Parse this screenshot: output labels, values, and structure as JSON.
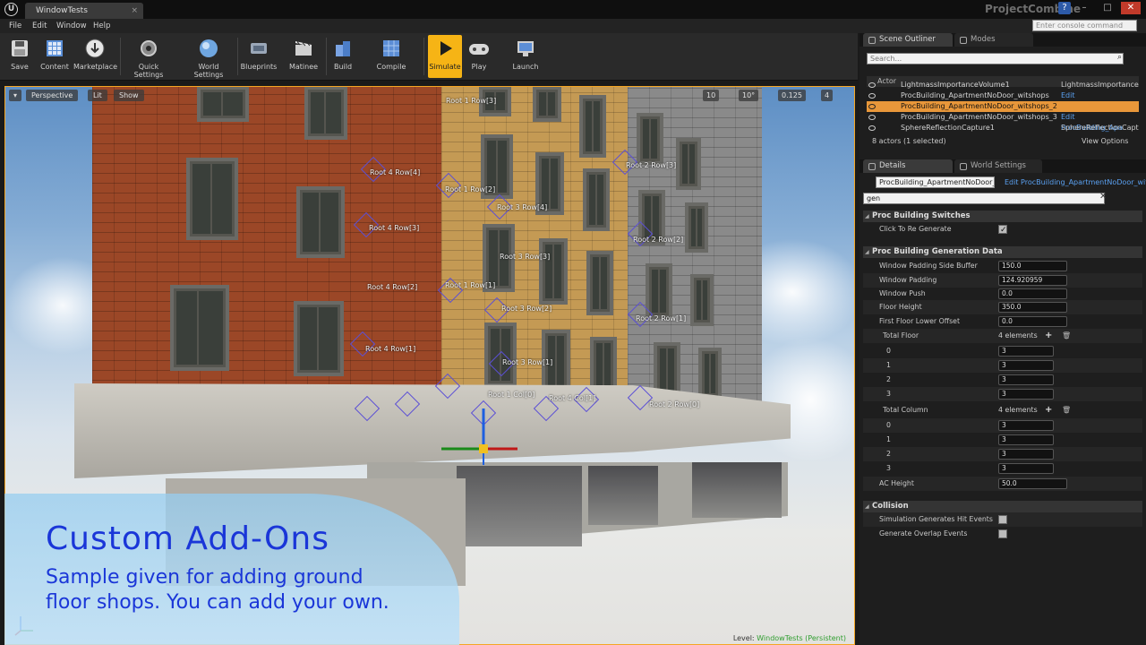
{
  "window": {
    "logo": "U",
    "doc_tab": "WindowTests",
    "doc_tab_close": "×",
    "project_name": "ProjectCombine",
    "help": "?",
    "minimize": "–",
    "maximize": "□",
    "close": "✕"
  },
  "menu": {
    "items": [
      "File",
      "Edit",
      "Window",
      "Help"
    ],
    "console_placeholder": "Enter console command"
  },
  "toolbar": {
    "buttons": [
      {
        "label": "Save",
        "icon": "save-icon"
      },
      {
        "label": "Content",
        "icon": "content-browser-icon"
      },
      {
        "label": "Marketplace",
        "icon": "marketplace-icon"
      },
      {
        "label": "Quick Settings",
        "icon": "quick-settings-icon"
      },
      {
        "label": "World Settings",
        "icon": "world-settings-icon"
      },
      {
        "label": "Blueprints",
        "icon": "blueprints-icon"
      },
      {
        "label": "Matinee",
        "icon": "matinee-icon"
      },
      {
        "label": "Build",
        "icon": "build-icon"
      },
      {
        "label": "Compile",
        "icon": "compile-icon"
      },
      {
        "label": "Simulate",
        "icon": "simulate-icon"
      },
      {
        "label": "Play",
        "icon": "play-icon"
      },
      {
        "label": "Launch",
        "icon": "launch-icon"
      }
    ]
  },
  "viewport": {
    "perspective": "Perspective",
    "lit": "Lit",
    "show": "Show",
    "grid_snap": "10",
    "rot_snap": "10°",
    "scale_snap": "0.125",
    "cam_speed": "4",
    "level_prefix": "Level:",
    "level_name": "WindowTests (Persistent)",
    "labels": [
      "Root 1 Row[3]",
      "Root 4 Row[4]",
      "Root 1 Row[2]",
      "Root 3 Row[4]",
      "Root 4 Row[3]",
      "Root 2 Row[3]",
      "Root 2 Row[2]",
      "Root 3 Row[3]",
      "Root 4 Row[2]",
      "Root 1 Row[1]",
      "Root 3 Row[2]",
      "Root 2 Row[1]",
      "Root 4 Row[1]",
      "Root 3 Row[1]",
      "Root 1 Col[0]",
      "Root 4 Col[1]",
      "Root 2 Row[0]"
    ]
  },
  "caption": {
    "title": "Custom Add-Ons",
    "line1": "Sample given  for adding ground",
    "line2": "floor shops. You can add your own."
  },
  "outliner": {
    "tab": "Scene Outliner",
    "modes_tab": "Modes",
    "search_placeholder": "Search...",
    "col_actor": "Actor",
    "rows": [
      {
        "name": "LightmassImportanceVolume1",
        "type": "LightmassImportance",
        "selected": false
      },
      {
        "name": "ProcBuilding_ApartmentNoDoor_witshops",
        "type": "Edit ProcBuilding_Apa",
        "selected": false
      },
      {
        "name": "ProcBuilding_ApartmentNoDoor_witshops_2",
        "type": "Edit ProcBuilding_Apa",
        "selected": true
      },
      {
        "name": "ProcBuilding_ApartmentNoDoor_witshops_3",
        "type": "Edit ProcBuilding_Apa",
        "selected": false
      },
      {
        "name": "SphereReflectionCapture1",
        "type": "SphereReflectionCapt",
        "selected": false
      }
    ],
    "footer": "8 actors (1 selected)",
    "view_options": "View Options"
  },
  "details": {
    "tab": "Details",
    "world_tab": "World Settings",
    "actor_name": "ProcBuilding_ApartmentNoDoor_wit",
    "edit_link": "Edit ProcBuilding_ApartmentNoDoor_wits",
    "filter": "gen",
    "sections": {
      "switches": "Proc Building Switches",
      "generation": "Proc Building Generation Data",
      "collision": "Collision"
    },
    "props": {
      "click_regen": "Click To Re Generate",
      "win_pad_side": "Window Padding Side Buffer",
      "win_pad_side_v": "150.0",
      "win_pad": "Window Padding",
      "win_pad_v": "124.920959",
      "win_push": "Window Push",
      "win_push_v": "0.0",
      "floor_h": "Floor Height",
      "floor_h_v": "350.0",
      "ff_lower": "First Floor Lower Offset",
      "ff_lower_v": "0.0",
      "total_floor": "Total Floor",
      "total_floor_count": "4 elements",
      "total_col": "Total Column",
      "total_col_count": "4 elements",
      "ac_height": "AC Height",
      "ac_height_v": "50.0",
      "sim_hit": "Simulation Generates Hit Events",
      "gen_overlap": "Generate Overlap Events"
    },
    "floor_items": [
      {
        "i": "0",
        "v": "3"
      },
      {
        "i": "1",
        "v": "3"
      },
      {
        "i": "2",
        "v": "3"
      },
      {
        "i": "3",
        "v": "3"
      }
    ],
    "col_items": [
      {
        "i": "0",
        "v": "3"
      },
      {
        "i": "1",
        "v": "3"
      },
      {
        "i": "2",
        "v": "3"
      },
      {
        "i": "3",
        "v": "3"
      }
    ]
  }
}
